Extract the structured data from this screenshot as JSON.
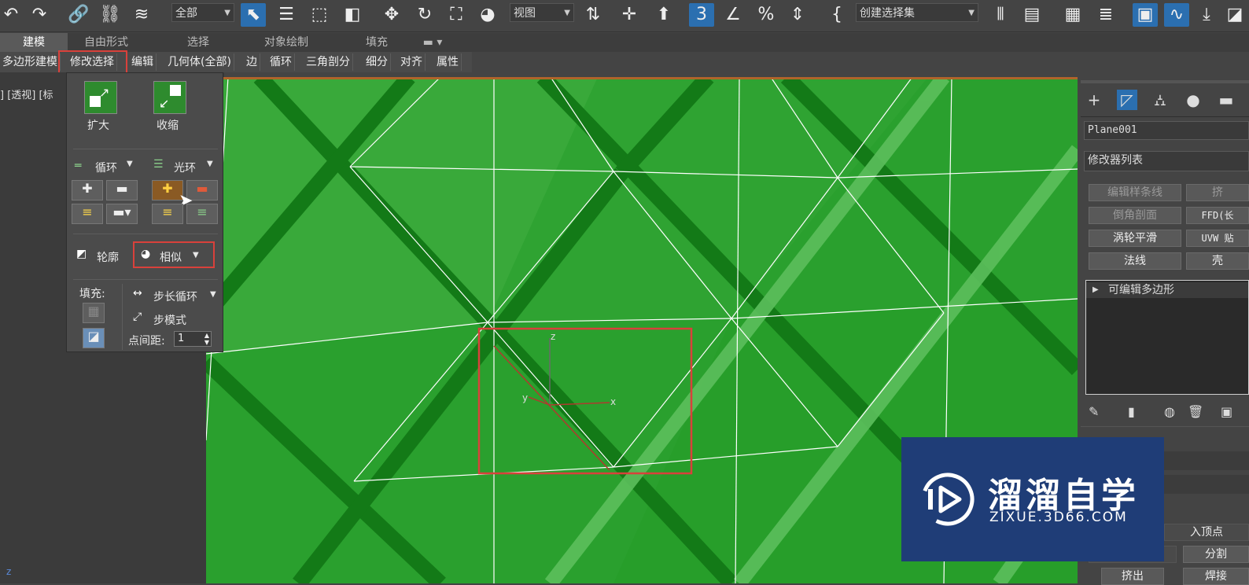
{
  "toolbar": {
    "selection_filter": "全部",
    "ref_coord": "视图",
    "selection_set_placeholder": "创建选择集",
    "snap_label": "3"
  },
  "ribbon": {
    "tabs": [
      "建模",
      "自由形式",
      "选择",
      "对象绘制",
      "填充"
    ],
    "subtabs": [
      "多边形建模",
      "修改选择",
      "编辑",
      "几何体(全部)",
      "边",
      "循环",
      "三角剖分",
      "细分",
      "对齐",
      "属性"
    ]
  },
  "viewport": {
    "labels": "] [透视] [标",
    "axis_x": "x",
    "axis_y": "y",
    "axis_z": "z",
    "corner_axis": "z",
    "colors": {
      "face": "#2aa02e",
      "face_light": "#46b046",
      "band_dark": "#137a17",
      "band_light": "#5cbf5c",
      "edge": "#ffffff"
    }
  },
  "modify_selection_panel": {
    "grow": "扩大",
    "shrink": "收缩",
    "loop": "循环",
    "ring": "光环",
    "outline": "轮廓",
    "similar": "相似",
    "fill": "填充:",
    "step_loop": "步长循环",
    "step_mode": "步模式",
    "dot_gap_label": "点间距:",
    "dot_gap_value": "1"
  },
  "command_panel": {
    "object_name": "Plane001",
    "modifier_list": "修改器列表",
    "buttons": [
      "编辑样条线",
      "挤",
      "倒角剖面",
      "FFD(长",
      "涡轮平滑",
      "UVW 贴",
      "法线",
      "壳"
    ],
    "stack_item": "可编辑多边形",
    "partial_labels": [
      "入顶点",
      "分割",
      "挤出",
      "焊接"
    ]
  },
  "watermark": {
    "brand": "溜溜自学",
    "url": "ZIXUE.3D66.COM"
  }
}
